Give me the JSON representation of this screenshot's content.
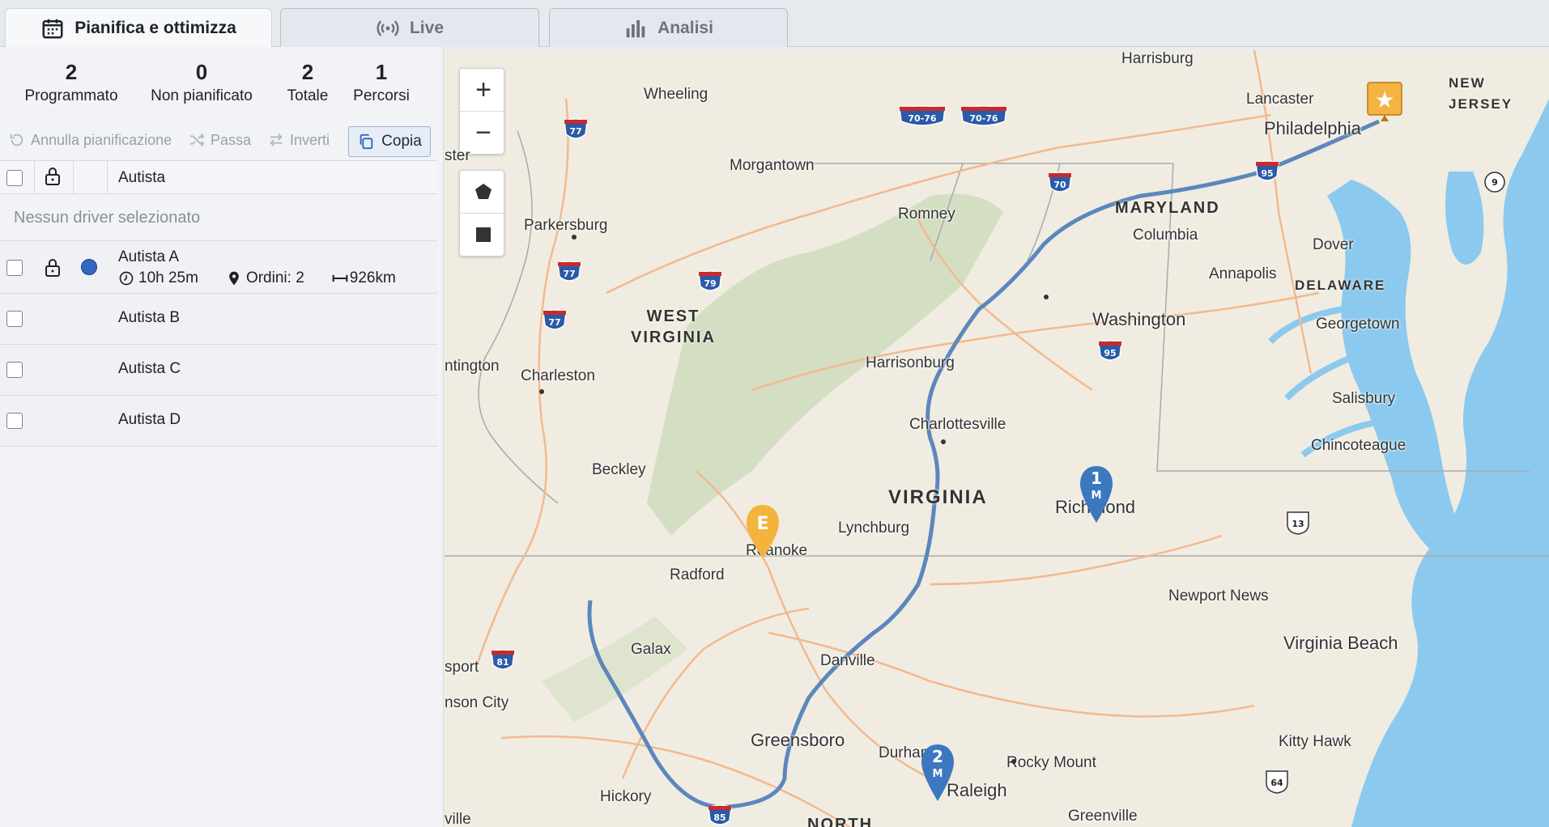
{
  "tabs": [
    {
      "label": "Pianifica e ottimizza",
      "icon": "calendar-icon",
      "active": true
    },
    {
      "label": "Live",
      "icon": "broadcast-icon",
      "active": false
    },
    {
      "label": "Analisi",
      "icon": "bar-chart-icon",
      "active": false
    }
  ],
  "stats": [
    {
      "value": "2",
      "label": "Programmato"
    },
    {
      "value": "0",
      "label": "Non pianificato"
    },
    {
      "value": "2",
      "label": "Totale"
    },
    {
      "value": "1",
      "label": "Percorsi"
    }
  ],
  "toolbar": {
    "undo_label": "Annulla pianificazione",
    "pass_label": "Passa",
    "invert_label": "Inverti",
    "copy_label": "Copia"
  },
  "table": {
    "header_label": "Autista",
    "empty_label": "Nessun driver selezionato",
    "drivers": [
      {
        "name": "Autista A",
        "duration": "10h 25m",
        "orders": "Ordini: 2",
        "distance": "926km",
        "color": "#3268c4"
      },
      {
        "name": "Autista B"
      },
      {
        "name": "Autista C"
      },
      {
        "name": "Autista D"
      }
    ]
  },
  "map": {
    "zoom_in": "+",
    "zoom_out": "−",
    "route_color": "#5b87bd",
    "states": [
      "WEST\nVIRGINIA",
      "VIRGINIA",
      "MARYLAND",
      "DELAWARE",
      "NEW\nJERSEY",
      "NORTH"
    ],
    "cities": [
      "Harrisburg",
      "Wheeling",
      "Lancaster",
      "Philadelphia",
      "Morgantown",
      "Romney",
      "Columbia",
      "Parkersburg",
      "Dover",
      "Annapolis",
      "Washington",
      "Georgetown",
      "Harrisonburg",
      "ntington",
      "Charleston",
      "Salisbury",
      "Charlottesville",
      "Chincoteague",
      "Beckley",
      "Richmond",
      "Lynchburg",
      "Roanoke",
      "Radford",
      "Newport News",
      "Galax",
      "Virginia Beach",
      "Danville",
      "sport",
      "nson City",
      "Greensboro",
      "Durham",
      "Raleigh",
      "Kitty Hawk",
      "Rocky Mount",
      "Hickory",
      "Greenville",
      "ville",
      "ster"
    ],
    "shields": [
      "77",
      "70-76",
      "70-76",
      "70",
      "95",
      "9",
      "77",
      "79",
      "77",
      "95",
      "13",
      "81",
      "85",
      "64"
    ],
    "markers": {
      "start": "★",
      "stop1": {
        "num": "1",
        "sub": "M"
      },
      "stop2": {
        "num": "2",
        "sub": "M"
      },
      "end": "E"
    }
  }
}
